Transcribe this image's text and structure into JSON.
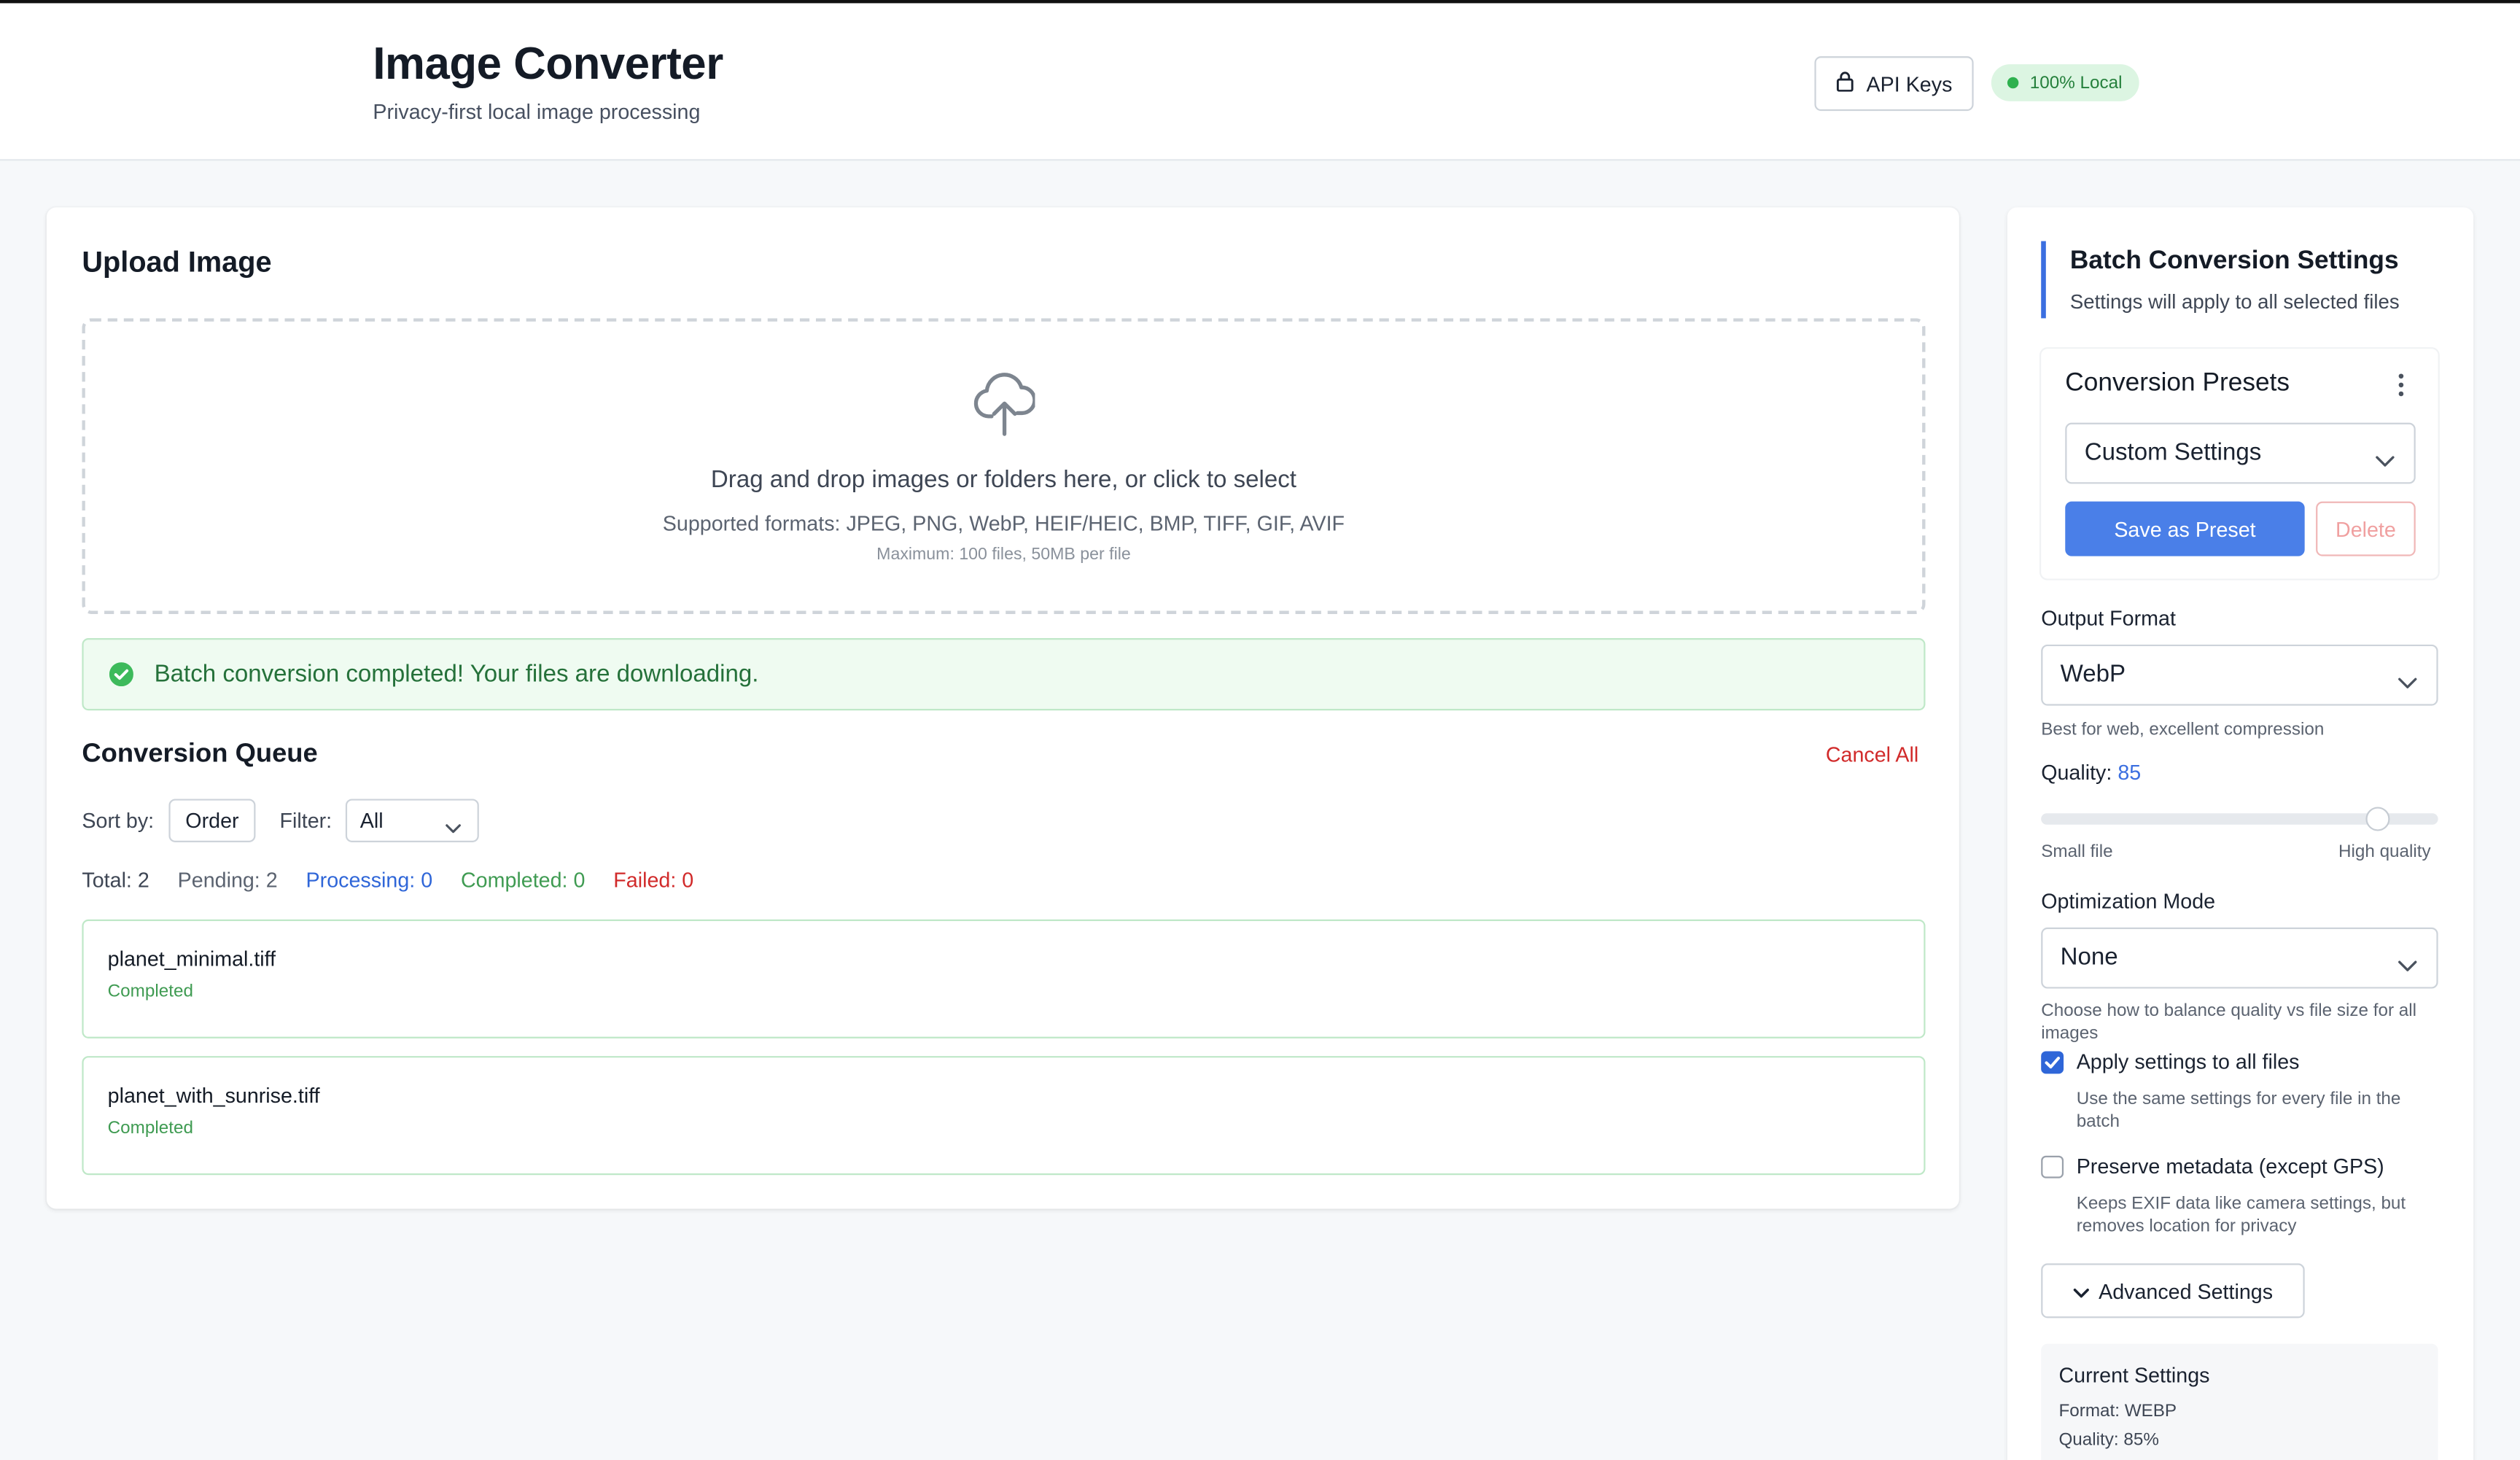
{
  "header": {
    "title": "Image Converter",
    "subtitle": "Privacy-first local image processing",
    "api_keys_label": "API Keys",
    "local_badge": "100% Local"
  },
  "upload": {
    "title": "Upload Image",
    "drop_text": "Drag and drop images or folders here, or click to select",
    "formats": "Supported formats: JPEG, PNG, WebP, HEIF/HEIC, BMP, TIFF, GIF, AVIF",
    "max": "Maximum: 100 files, 50MB per file"
  },
  "success": {
    "message": "Batch conversion completed! Your files are downloading."
  },
  "queue": {
    "title": "Conversion Queue",
    "cancel_all": "Cancel All",
    "sort_label": "Sort by:",
    "sort_value": "Order",
    "filter_label": "Filter:",
    "filter_value": "All",
    "stats": {
      "total": "Total: 2",
      "pending": "Pending: 2",
      "processing": "Processing: 0",
      "completed": "Completed: 0",
      "failed": "Failed: 0"
    },
    "items": [
      {
        "name": "planet_minimal.tiff",
        "status": "Completed"
      },
      {
        "name": "planet_with_sunrise.tiff",
        "status": "Completed"
      }
    ]
  },
  "settings": {
    "title": "Batch Conversion Settings",
    "subtitle": "Settings will apply to all selected files",
    "presets_title": "Conversion Presets",
    "preset_value": "Custom Settings",
    "save_preset": "Save as Preset",
    "delete": "Delete",
    "output_format_label": "Output Format",
    "output_format_value": "WebP",
    "output_format_hint": "Best for web, excellent compression",
    "quality_label": "Quality:",
    "quality_value": "85",
    "quality_level": 0.85,
    "slider_min": "Small file",
    "slider_max": "High quality",
    "opt_mode_label": "Optimization Mode",
    "opt_mode_value": "None",
    "opt_mode_hint": "Choose how to balance quality vs file size for all images",
    "apply_all_label": "Apply settings to all files",
    "apply_all_checked": true,
    "apply_all_hint": "Use the same settings for every file in the batch",
    "preserve_label": "Preserve metadata (except GPS)",
    "preserve_checked": false,
    "preserve_hint": "Keeps EXIF data like camera settings, but removes location for privacy",
    "advanced_label": "Advanced Settings",
    "current_title": "Current Settings",
    "current_format": "Format: WEBP",
    "current_quality": "Quality: 85%"
  },
  "colors": {
    "accent": "#3b6fe0",
    "success": "#25803c",
    "danger": "#d12a2a",
    "processing": "#2f66d8"
  },
  "icons": {
    "api": "lock-icon",
    "upload": "cloud-upload-icon",
    "success": "check-circle-icon",
    "dropdown": "chevron-down-icon",
    "menu": "kebab-menu-icon",
    "checkbox": "checkmark-icon"
  }
}
